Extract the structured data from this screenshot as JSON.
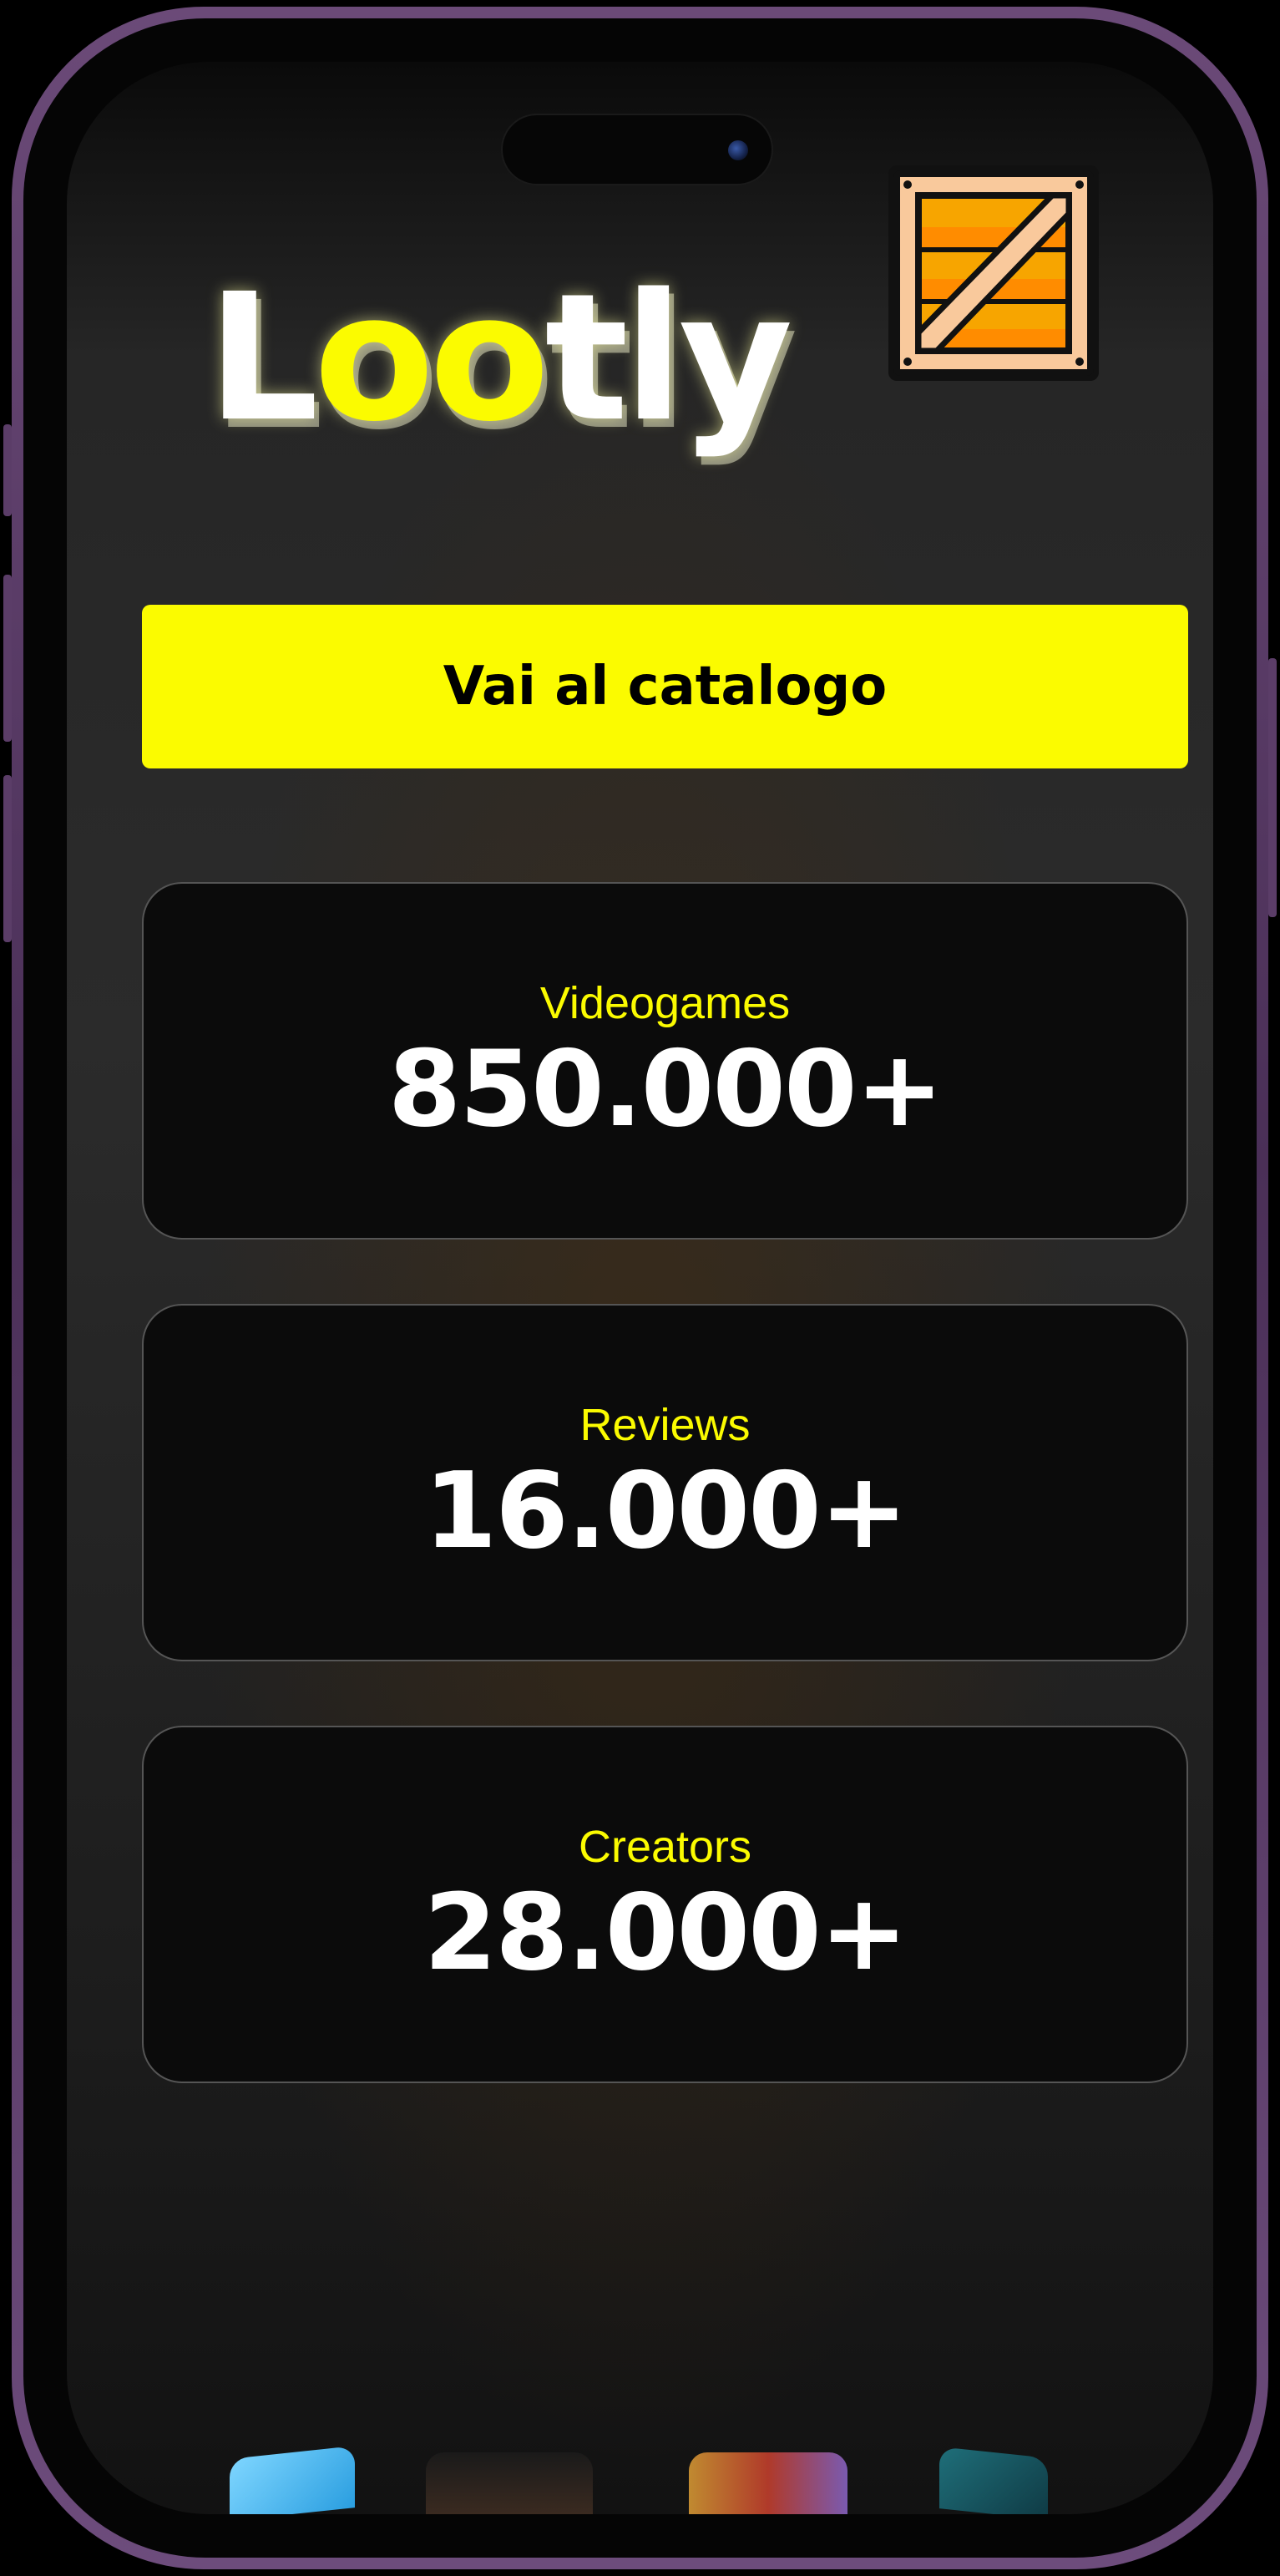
{
  "app": {
    "logo_part1": "L",
    "logo_part2": "oo",
    "logo_part3": "tly",
    "accent_color": "#fbfb00"
  },
  "cta": {
    "label": "Vai al catalogo"
  },
  "stats": [
    {
      "label": "Videogames",
      "value": "850.000+"
    },
    {
      "label": "Reviews",
      "value": "16.000+"
    },
    {
      "label": "Creators",
      "value": "28.000+"
    }
  ],
  "icons": {
    "logo_icon": "crate-icon"
  }
}
